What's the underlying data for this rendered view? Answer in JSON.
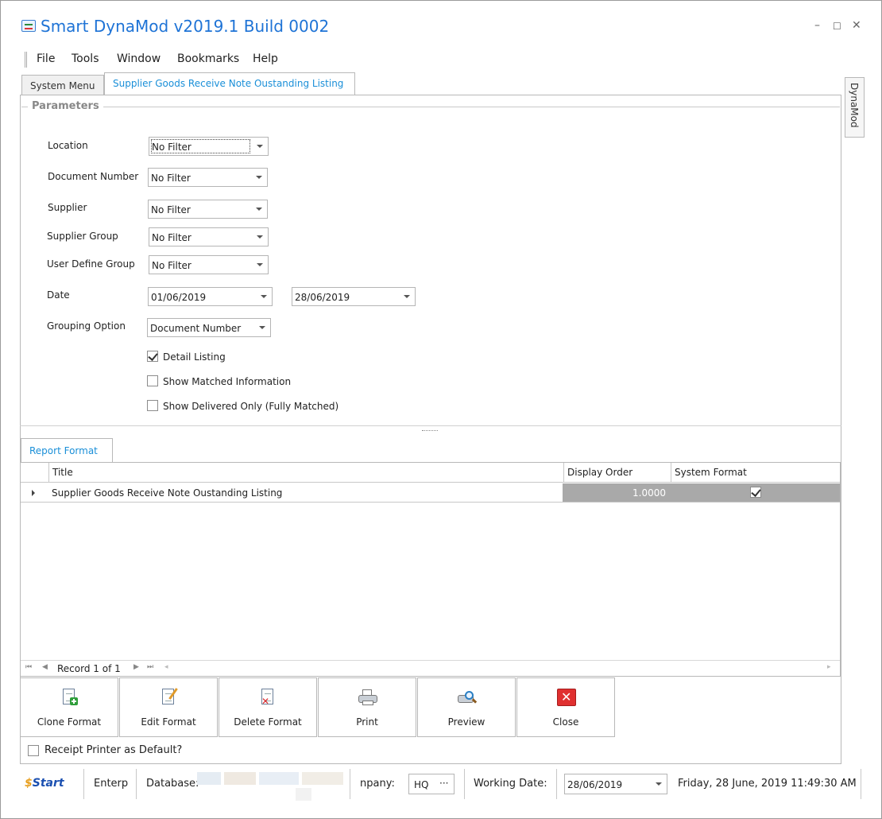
{
  "window": {
    "title": "Smart DynaMod v2019.1 Build 0002",
    "controls": {
      "minimize": "–",
      "maximize": "☐",
      "close": "✕"
    }
  },
  "menu": [
    "File",
    "Tools",
    "Window",
    "Bookmarks",
    "Help"
  ],
  "tabs": [
    {
      "label": "System Menu",
      "active": false
    },
    {
      "label": "Supplier Goods Receive Note Oustanding Listing",
      "active": true
    }
  ],
  "side_tab": {
    "label": "DynaMod"
  },
  "parameters": {
    "title": "Parameters",
    "fields": [
      {
        "label": "Location",
        "value": "No Filter"
      },
      {
        "label": "Document Number",
        "value": "No Filter"
      },
      {
        "label": "Supplier",
        "value": "No Filter"
      },
      {
        "label": "Supplier Group",
        "value": "No Filter"
      },
      {
        "label": "User Define Group",
        "value": "No Filter"
      }
    ],
    "date": {
      "label": "Date",
      "from": "01/06/2019",
      "to": "28/06/2019"
    },
    "grouping": {
      "label": "Grouping Option",
      "value": "Document Number"
    },
    "checkboxes": [
      {
        "label": "Detail Listing",
        "checked": true
      },
      {
        "label": "Show Matched Information",
        "checked": false
      },
      {
        "label": "Show Delivered Only (Fully Matched)",
        "checked": false
      }
    ]
  },
  "report_format": {
    "tab": "Report Format",
    "columns": [
      "Title",
      "Display Order",
      "System Format"
    ],
    "rows": [
      {
        "title": "Supplier Goods Receive Note Oustanding Listing",
        "display_order": "1.0000",
        "system_format": true
      }
    ],
    "navigator": {
      "record": "Record 1 of 1"
    }
  },
  "buttons": [
    {
      "label": "Clone Format",
      "icon": "clone-format-icon"
    },
    {
      "label": "Edit Format",
      "icon": "edit-format-icon"
    },
    {
      "label": "Delete Format",
      "icon": "delete-format-icon"
    },
    {
      "label": "Print",
      "icon": "printer-icon"
    },
    {
      "label": "Preview",
      "icon": "preview-icon"
    },
    {
      "label": "Close",
      "icon": "close-icon"
    }
  ],
  "receipt_printer": {
    "label": "Receipt Printer as Default?",
    "checked": false
  },
  "statusbar": {
    "logo": "Start",
    "edition": "Enterp",
    "database_label": "Database:",
    "company_label": "npany:",
    "company_value": "HQ",
    "company_more": "···",
    "working_date_label": "Working Date:",
    "working_date_value": "28/06/2019",
    "datetime": "Friday, 28 June, 2019 11:49:30 AM"
  },
  "colors": {
    "accent": "#1a8fd8",
    "title": "#1e73d6",
    "grid_gray": "#a9a9a9",
    "close_red": "#e03030"
  }
}
